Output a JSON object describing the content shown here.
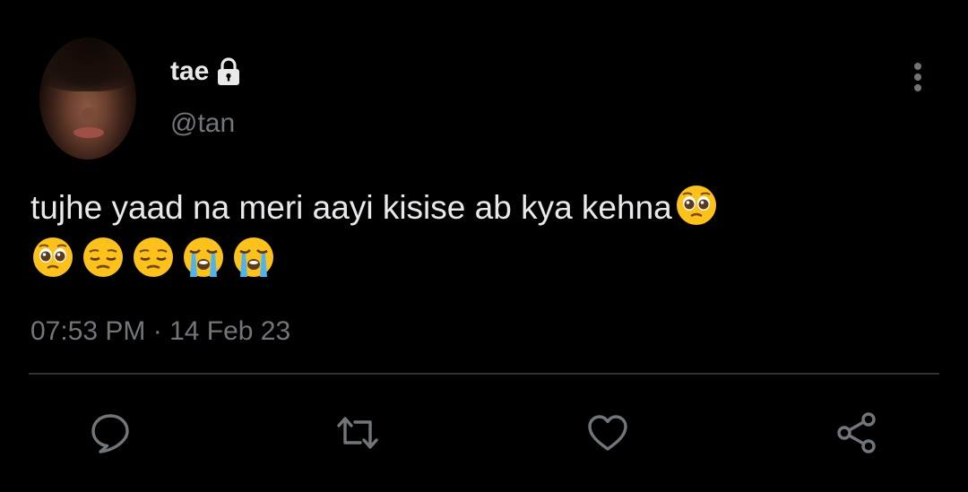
{
  "user": {
    "display_name": "tae",
    "handle": "@tan"
  },
  "tweet": {
    "text": "tujhe yaad na meri aayi kisise ab kya kehna",
    "trailing_emoji": "pleading-face",
    "emoji_line": [
      "pleading-face",
      "pensive-face",
      "pensive-face",
      "loudly-crying-face",
      "loudly-crying-face"
    ],
    "timestamp": "07:53 PM · 14 Feb 23"
  },
  "icons": {
    "lock": "lock-icon",
    "more": "more-vertical-icon",
    "reply": "reply-icon",
    "retweet": "retweet-icon",
    "like": "heart-icon",
    "share": "share-icon"
  },
  "colors": {
    "background": "#000000",
    "primary_text": "#e7e9ea",
    "secondary_text": "#71767b",
    "divider": "#2f3336"
  }
}
